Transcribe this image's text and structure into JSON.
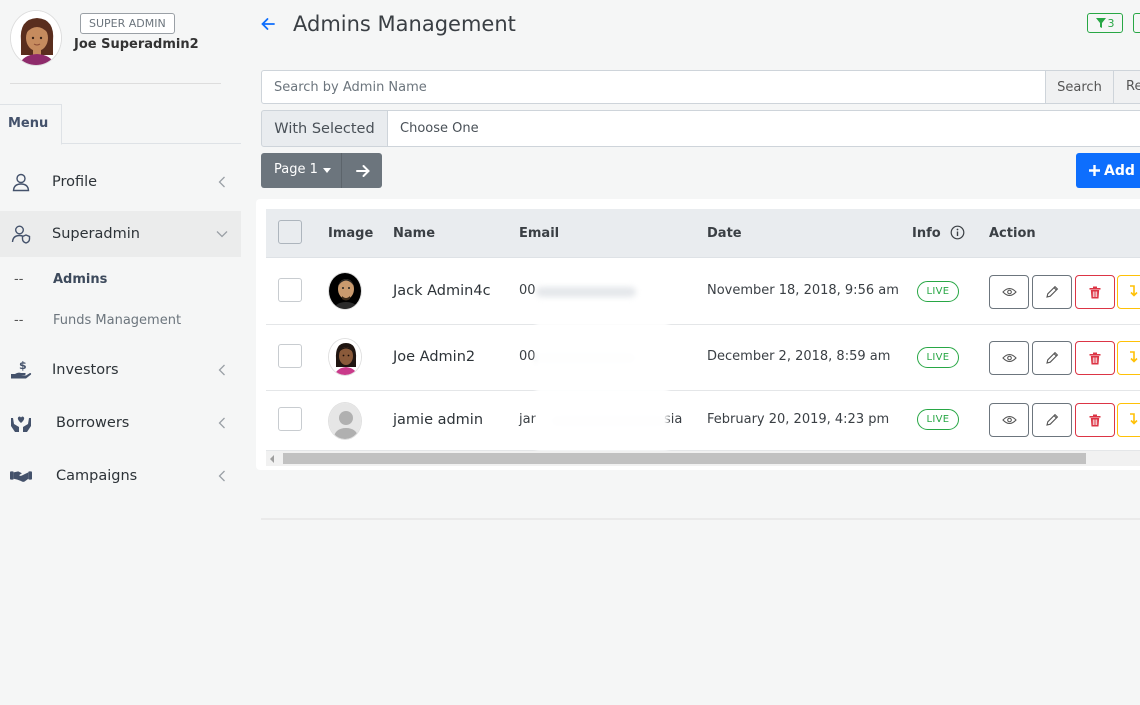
{
  "user": {
    "role": "SUPER ADMIN",
    "name": "Joe Superadmin2"
  },
  "sidebar": {
    "menu_tab": "Menu",
    "items": [
      {
        "label": "Profile",
        "icon": "user-icon"
      },
      {
        "label": "Superadmin",
        "icon": "user-shield-icon"
      },
      {
        "label": "Investors",
        "icon": "hand-coin-icon"
      },
      {
        "label": "Borrowers",
        "icon": "hands-heart-icon"
      },
      {
        "label": "Campaigns",
        "icon": "handshake-icon"
      }
    ],
    "subitems": [
      {
        "dash": "--",
        "label": "Admins"
      },
      {
        "dash": "--",
        "label": "Funds Management"
      }
    ]
  },
  "header": {
    "title": "Admins Management",
    "filter_count": "3"
  },
  "search": {
    "placeholder": "Search by Admin Name",
    "search_label": "Search",
    "reset_label": "Re"
  },
  "bulk": {
    "label": "With Selected",
    "selected": "Choose One"
  },
  "pagination": {
    "label": "Page 1"
  },
  "add_button": {
    "label": "Add N"
  },
  "table": {
    "columns": [
      "Image",
      "Name",
      "Email",
      "Date",
      "Info",
      "Action"
    ],
    "rows": [
      {
        "name": "Jack Admin4c",
        "email": "00",
        "date": "November 18, 2018, 9:56 am",
        "status": "LIVE"
      },
      {
        "name": "Joe Admin2",
        "email": "00",
        "date": "December 2, 2018, 8:59 am",
        "status": "LIVE"
      },
      {
        "name": "jamie admin",
        "email": "jar",
        "email_tail": "sia",
        "date": "February 20, 2019, 4:23 pm",
        "status": "LIVE"
      }
    ]
  },
  "colors": {
    "primary": "#0d6efd",
    "success": "#28a745",
    "danger": "#dc3545",
    "warning": "#ffc107",
    "secondary": "#6c757d"
  }
}
